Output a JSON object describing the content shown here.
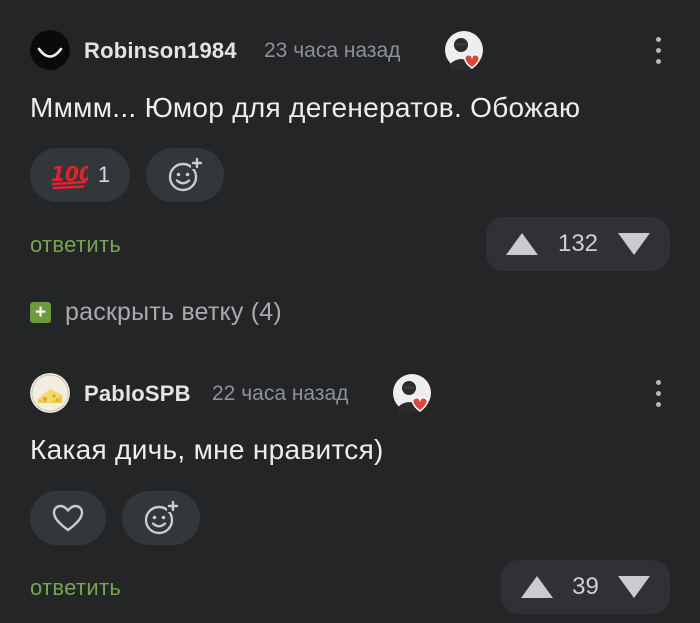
{
  "colors": {
    "background": "#232527",
    "pill": "#34373a",
    "reply_green": "#77a44f",
    "expand_green": "#6b9b3d",
    "vote_gray": "#c9cbce"
  },
  "comments": [
    {
      "username": "Robinson1984",
      "timestamp": "23 часа назад",
      "avatar_icon": "smiley-face-avatar",
      "badge_icon": "heart-badge",
      "text": "Мммм... Юмор для дегенератов. Обожаю",
      "reaction": {
        "emoji": "💯",
        "count": "1"
      },
      "add_reaction_icon": "smile-plus-icon",
      "reply_label": "ответить",
      "votes": "132"
    },
    {
      "username": "PabloSPB",
      "timestamp": "22 часа назад",
      "avatar_icon": "cheese-avatar",
      "badge_icon": "heart-badge",
      "text": "Какая дичь, мне нравится)",
      "like_icon": "heart-outline-icon",
      "add_reaction_icon": "smile-plus-icon",
      "reply_label": "ответить",
      "votes": "39"
    }
  ],
  "expand_thread": {
    "icon": "+",
    "label": "раскрыть ветку (4)"
  }
}
